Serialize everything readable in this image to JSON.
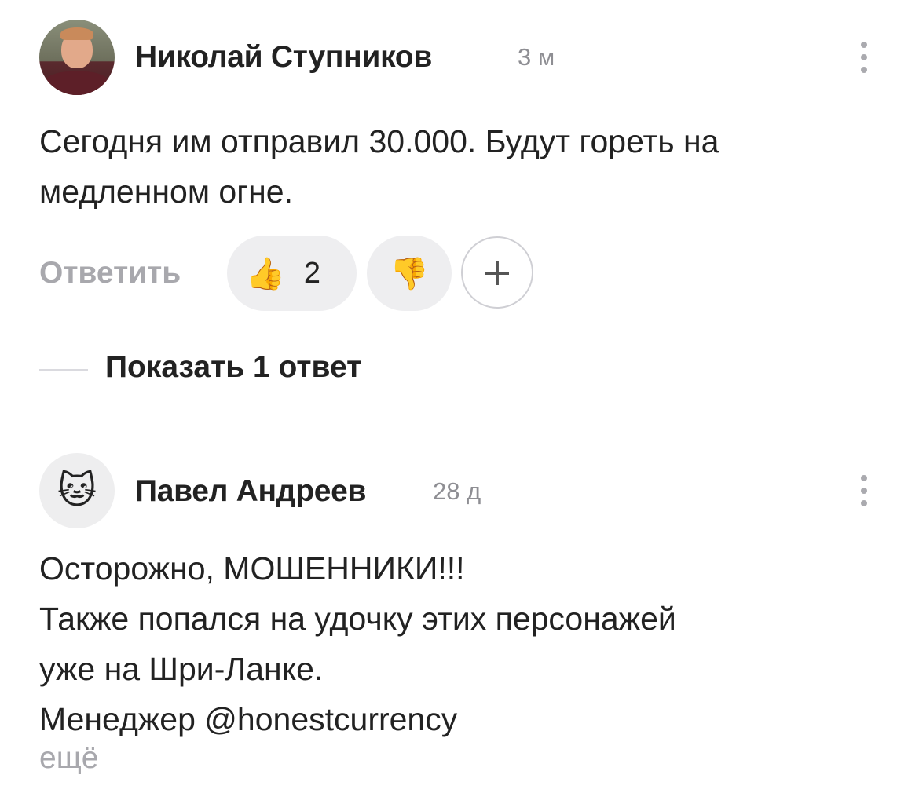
{
  "comments": [
    {
      "author": "Николай Ступников",
      "time": "3 м",
      "text_lines": [
        "Сегодня им отправил 30.000. Будут гореть на",
        "медленном огне."
      ],
      "actions": {
        "reply_label": "Ответить",
        "like_emoji": "👍",
        "like_count": "2",
        "dislike_emoji": "👎",
        "add_reaction": "+"
      },
      "show_replies_label": "Показать 1 ответ"
    },
    {
      "author": "Павел Андреев",
      "time": "28 д",
      "avatar_emoji": "🐱",
      "text_lines": [
        "Осторожно, МОШЕННИКИ!!!",
        "Также попался на удочку этих персонажей",
        "уже на Шри-Ланке.",
        "Менеджер @honestcurrency"
      ],
      "more_label": "ещё"
    }
  ],
  "icons": {
    "more": "more-vertical-icon",
    "add": "plus-icon"
  },
  "colors": {
    "muted": "#a8a8ad",
    "pill_bg": "#eeeef0",
    "text": "#222222"
  }
}
